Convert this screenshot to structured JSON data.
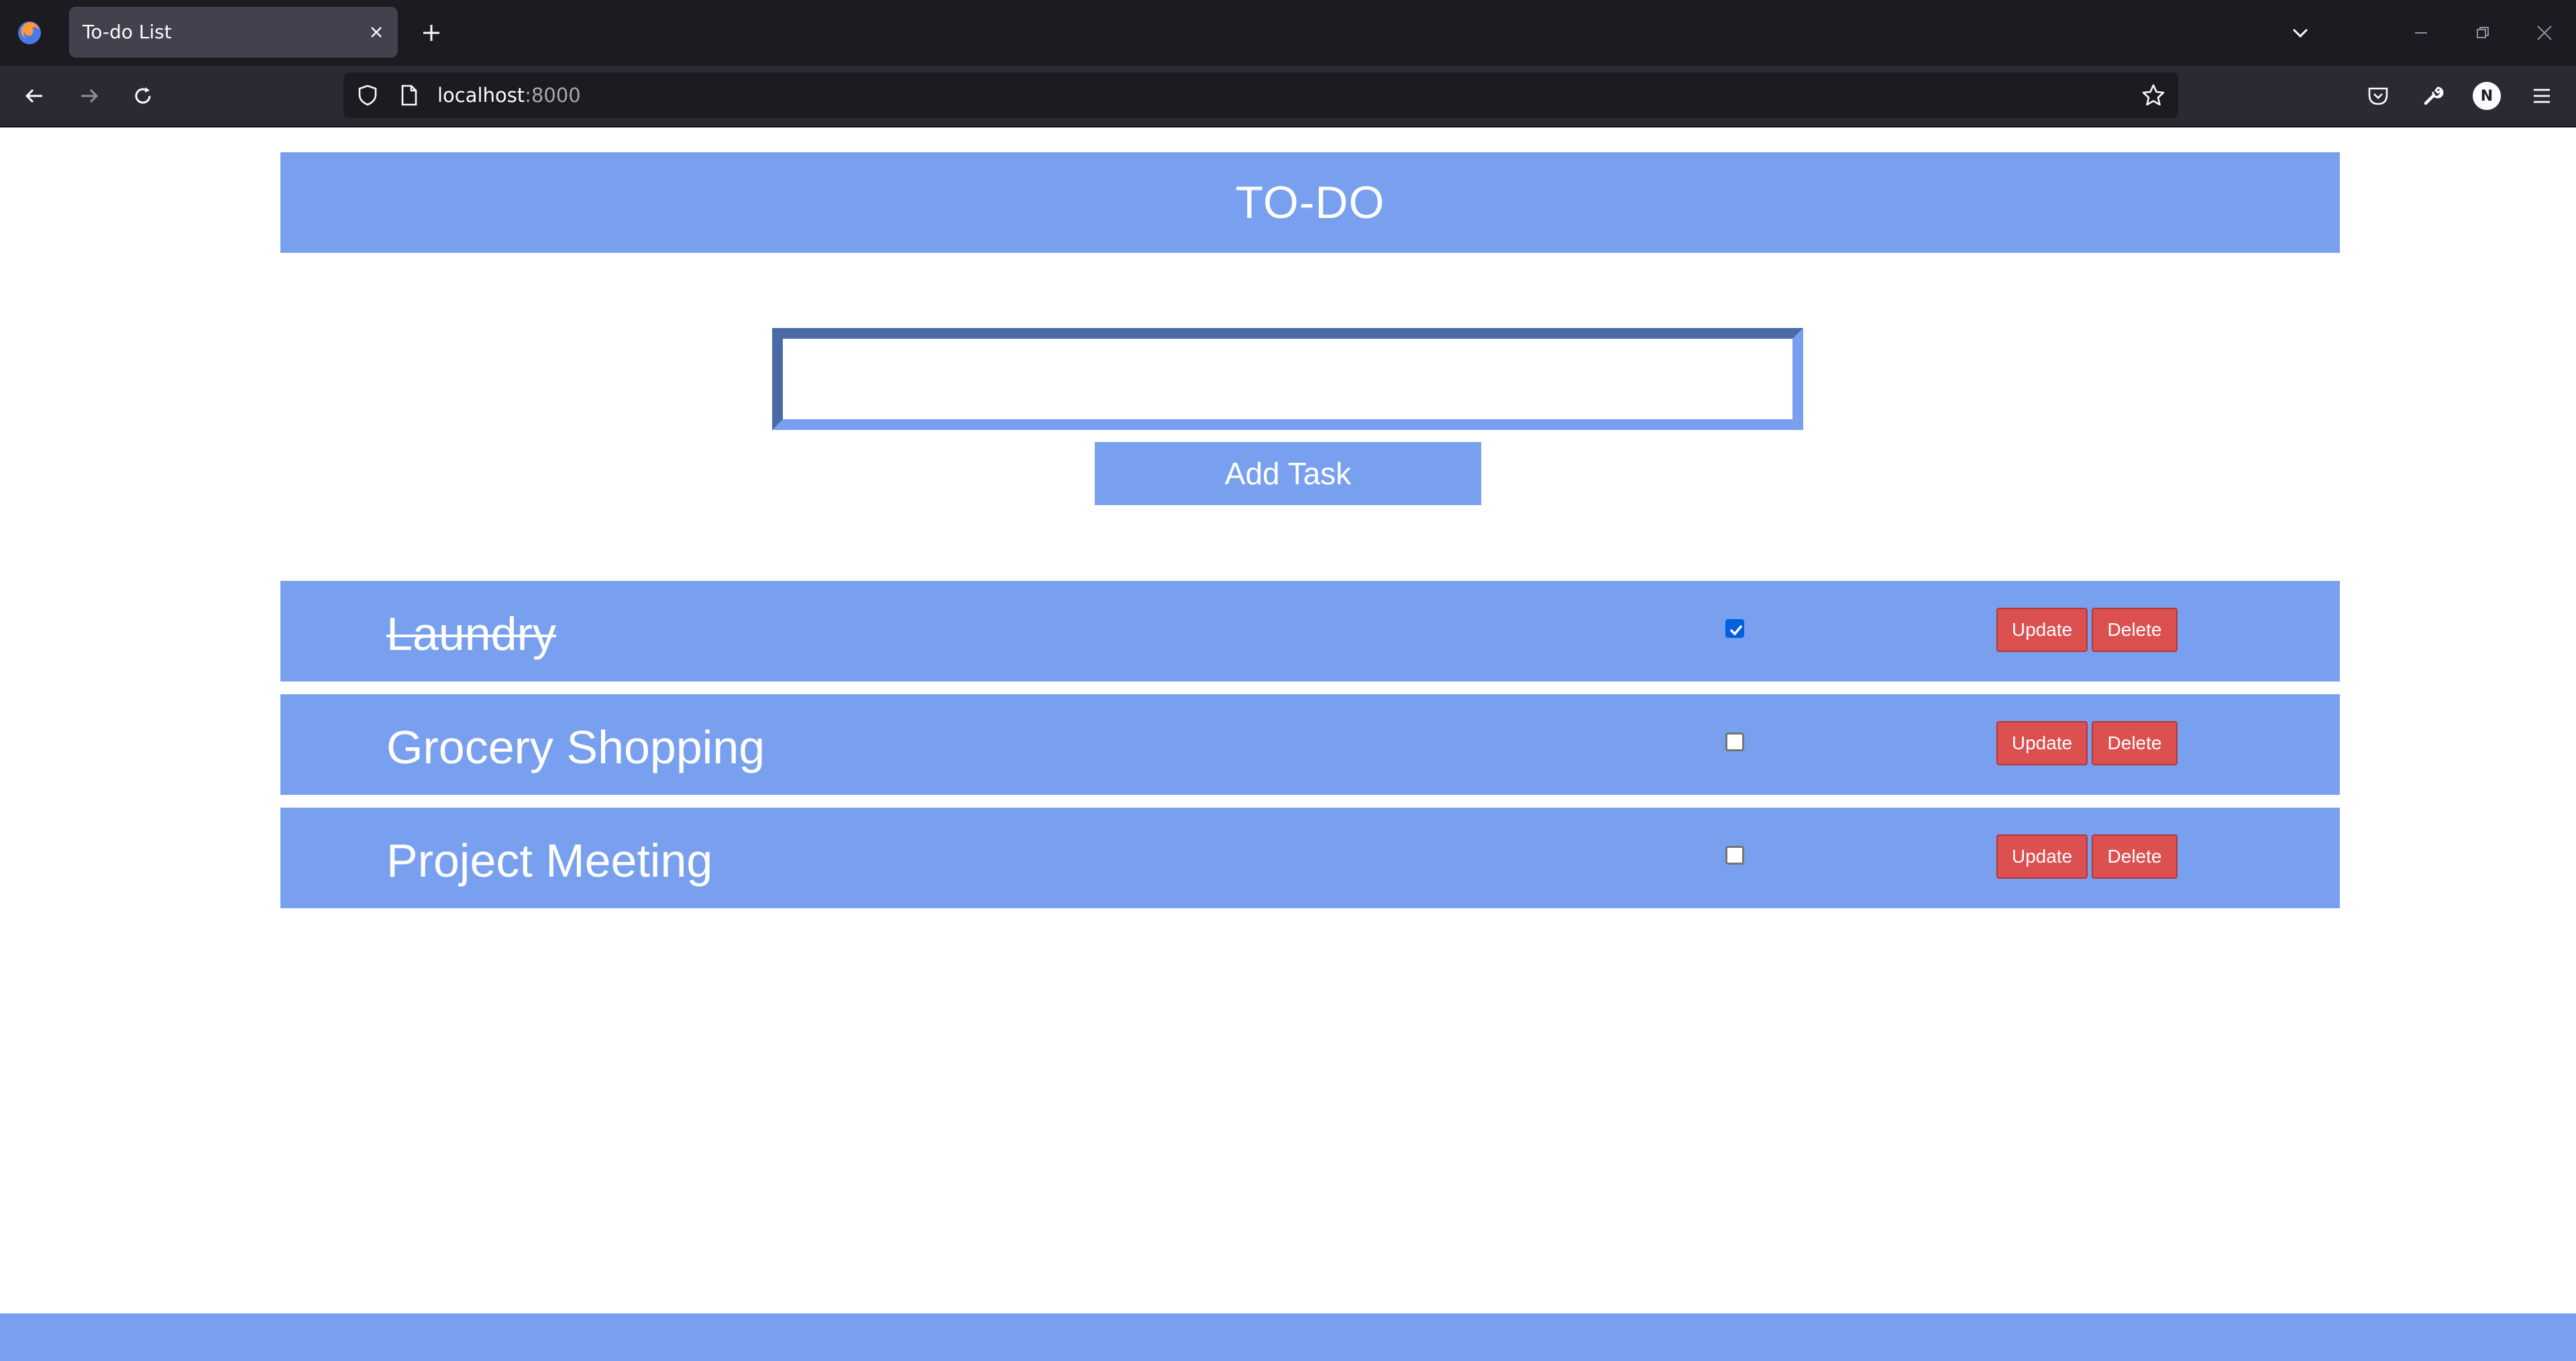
{
  "browser": {
    "tab_title": "To-do List",
    "url_host": "localhost",
    "url_port": ":8000",
    "profile_initial": "N"
  },
  "page": {
    "header_title": "TO-DO",
    "input_value": "",
    "input_placeholder": "",
    "add_button_label": "Add Task"
  },
  "tasks": [
    {
      "name": "Laundry",
      "completed": true,
      "update_label": "Update",
      "delete_label": "Delete"
    },
    {
      "name": "Grocery Shopping",
      "completed": false,
      "update_label": "Update",
      "delete_label": "Delete"
    },
    {
      "name": "Project Meeting",
      "completed": false,
      "update_label": "Update",
      "delete_label": "Delete"
    }
  ],
  "colors": {
    "accent": "#78a0ef",
    "danger": "#dc5050",
    "chrome_dark": "#1c1b22"
  }
}
